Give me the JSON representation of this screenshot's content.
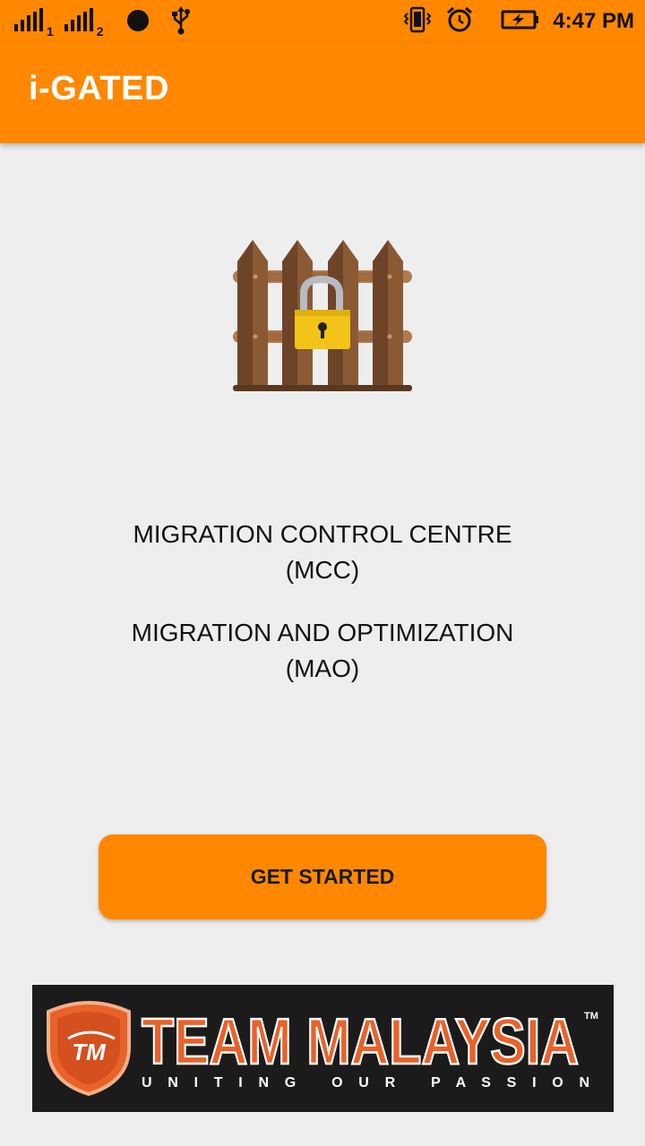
{
  "status_bar": {
    "sim1_label": "1",
    "sim2_label": "2",
    "time": "4:47 PM",
    "icons": [
      "signal-icon",
      "signal-icon",
      "notification-dot-icon",
      "usb-icon",
      "vibrate-icon",
      "alarm-icon",
      "battery-charging-icon"
    ]
  },
  "app_bar": {
    "title": "i-GATED"
  },
  "main": {
    "illustration": "locked-gate-icon",
    "line1_title": "MIGRATION CONTROL CENTRE",
    "line1_abbr": "(MCC)",
    "line2_title": "MIGRATION AND OPTIMIZATION",
    "line2_abbr": "(MAO)",
    "button_label": "GET STARTED"
  },
  "banner": {
    "logo_text": "TM",
    "title": "TEAM MALAYSIA",
    "trademark": "TM",
    "tagline": "U N I T I N G   O U R   P A S S I O N"
  },
  "colors": {
    "accent": "#ff8800",
    "background": "#eeeeee",
    "banner_bg": "#1b1b1b",
    "banner_orange": "#e8622a"
  }
}
